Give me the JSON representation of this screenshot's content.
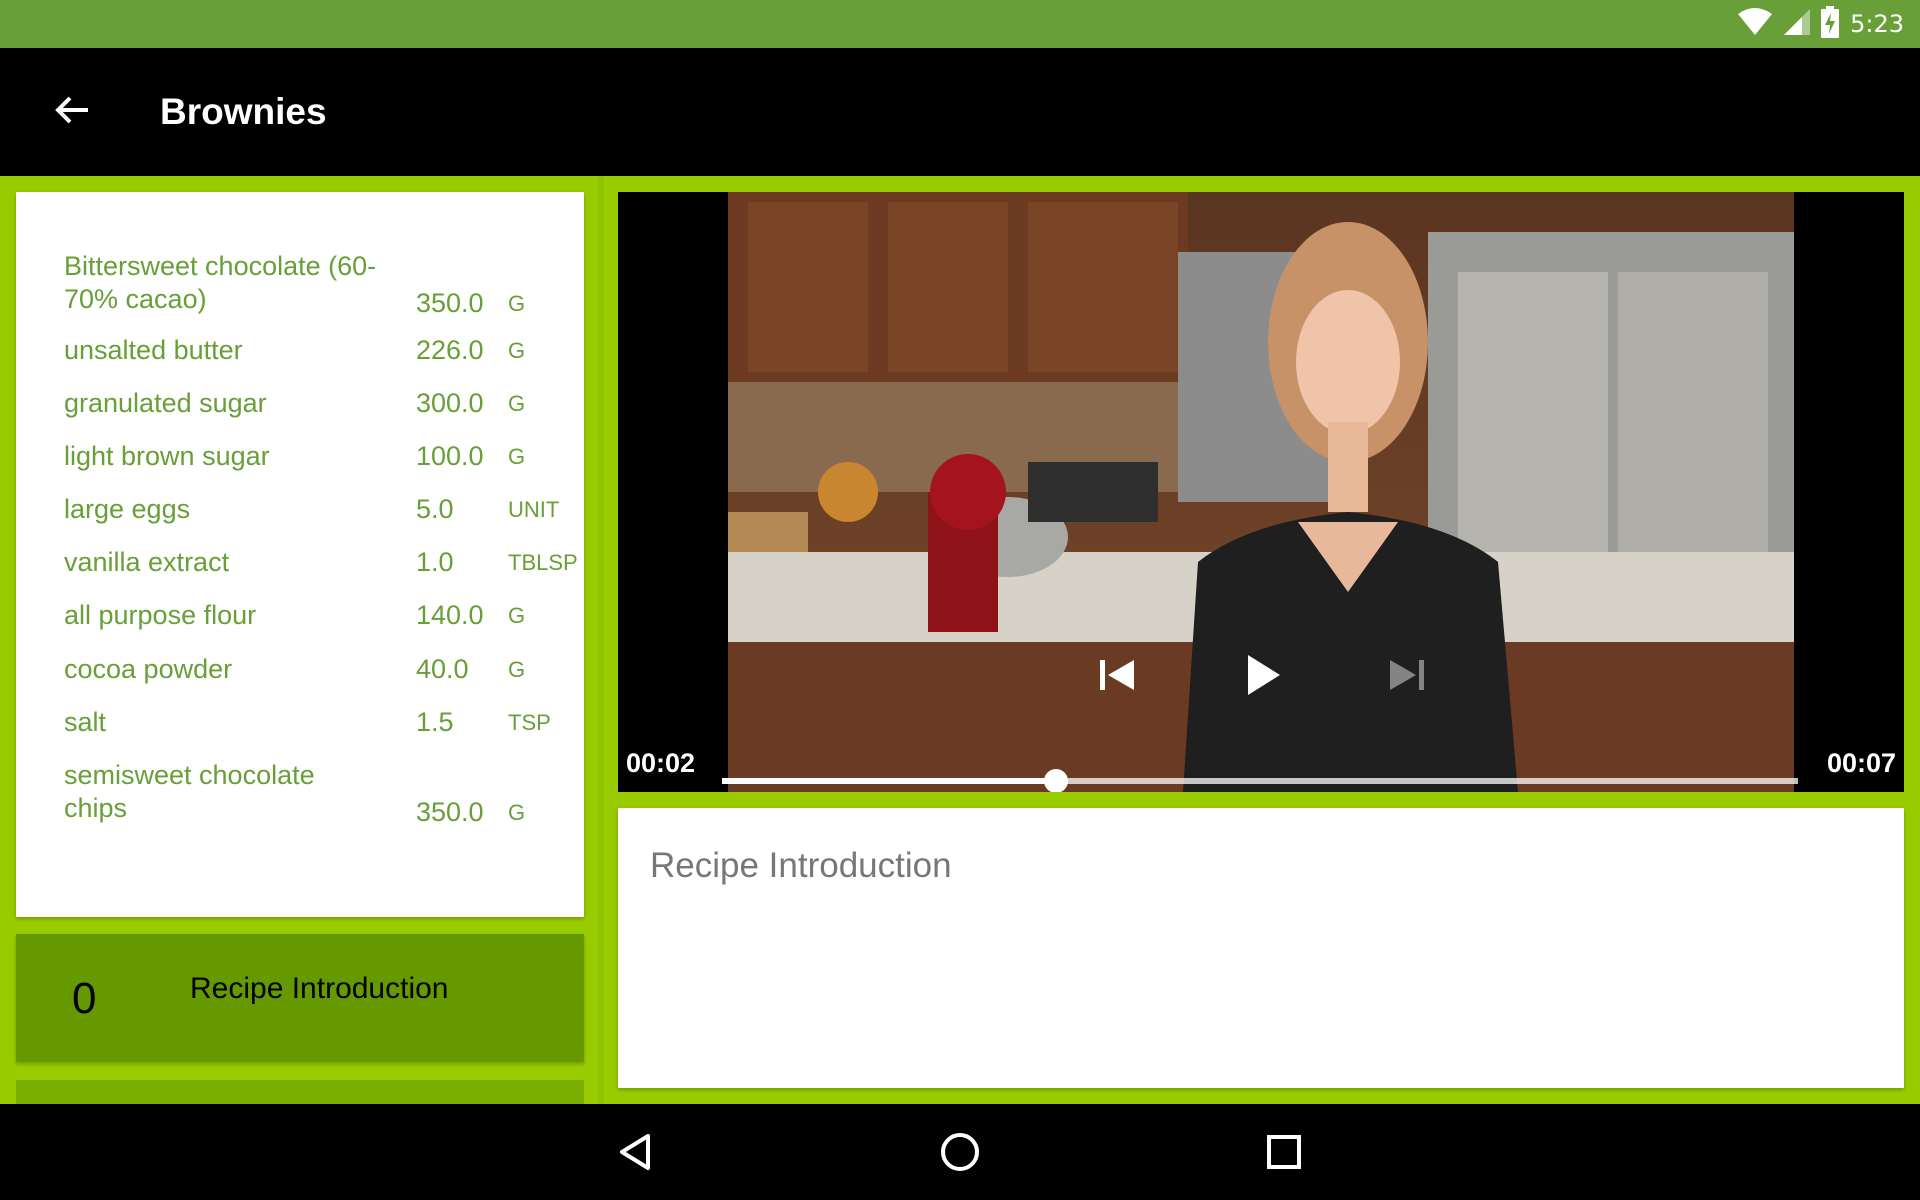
{
  "status_bar": {
    "time": "5:23",
    "icons": [
      "wifi-icon",
      "signal-icon",
      "battery-charging-icon"
    ]
  },
  "app_bar": {
    "title": "Brownies",
    "back_icon": "arrow-back-icon"
  },
  "ingredients": [
    {
      "name": "Bittersweet chocolate (60-70% cacao)",
      "quantity": "350.0",
      "unit": "G"
    },
    {
      "name": "unsalted butter",
      "quantity": "226.0",
      "unit": "G"
    },
    {
      "name": "granulated sugar",
      "quantity": "300.0",
      "unit": "G"
    },
    {
      "name": "light brown sugar",
      "quantity": "100.0",
      "unit": "G"
    },
    {
      "name": "large eggs",
      "quantity": "5.0",
      "unit": "UNIT"
    },
    {
      "name": "vanilla extract",
      "quantity": "1.0",
      "unit": "TBLSP"
    },
    {
      "name": "all purpose flour",
      "quantity": "140.0",
      "unit": "G"
    },
    {
      "name": "cocoa powder",
      "quantity": "40.0",
      "unit": "G"
    },
    {
      "name": "salt",
      "quantity": "1.5",
      "unit": "TSP"
    },
    {
      "name": "semisweet chocolate chips",
      "quantity": "350.0",
      "unit": "G"
    }
  ],
  "steps": [
    {
      "number": "0",
      "label": "Recipe Introduction"
    }
  ],
  "video": {
    "position": "00:02",
    "duration": "00:07",
    "progress": 0.31,
    "controls": [
      "skip-previous-icon",
      "play-icon",
      "skip-next-icon"
    ]
  },
  "description": {
    "text": "Recipe Introduction"
  },
  "nav_bar": {
    "icons": [
      "nav-back-icon",
      "nav-home-icon",
      "nav-recents-icon"
    ]
  },
  "colors": {
    "status_bar": "#689f38",
    "content_bg": "#99cc00",
    "ingredient_text": "#689f38",
    "step_card": "#669900",
    "app_bar": "#000000"
  }
}
